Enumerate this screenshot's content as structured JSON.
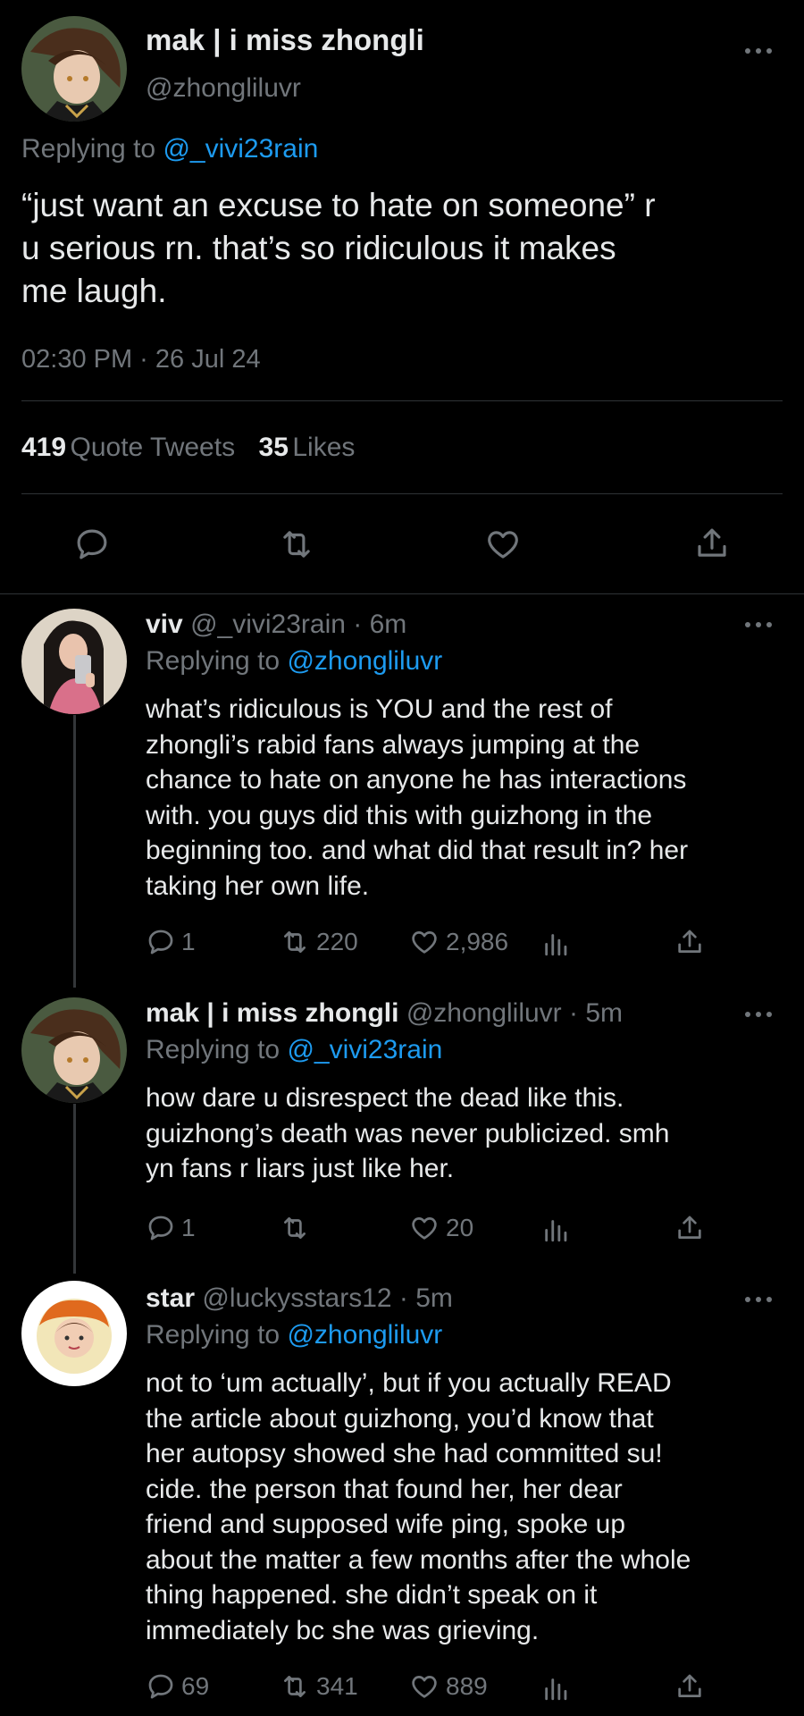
{
  "main_tweet": {
    "display_name": "mak | i miss zhongli",
    "handle": "@zhongliluvr",
    "replying_label": "Replying to",
    "replying_to": "@_vivi23rain",
    "text_lines": [
      "“just want an excuse to hate on someone” r",
      "u serious rn. that’s so ridiculous it makes",
      "me laugh."
    ],
    "timestamp": "02:30 PM · 26 Jul 24",
    "stats": {
      "quote_count": "419",
      "quote_label": "Quote Tweets",
      "like_count": "35",
      "like_label": "Likes"
    }
  },
  "replies": [
    {
      "display_name": "viv",
      "meta": "@_vivi23rain · 6m",
      "replying_label": "Replying to",
      "replying_to": "@zhongliluvr",
      "text_lines": [
        "what’s ridiculous is YOU and the rest of",
        "zhongli’s rabid fans always jumping at the",
        "chance to hate on anyone he has interactions",
        "with. you guys did this with guizhong in the",
        "beginning too. and what did that result in? her",
        "taking her own life."
      ],
      "reply_count": "1",
      "retweet_count": "220",
      "like_count": "2,986"
    },
    {
      "display_name": "mak | i miss zhongli",
      "meta": "@zhongliluvr · 5m",
      "replying_label": "Replying to",
      "replying_to": "@_vivi23rain",
      "text_lines": [
        "how dare u disrespect the dead like this.",
        "guizhong’s death was never publicized. smh",
        "yn fans r liars just like her."
      ],
      "reply_count": "1",
      "retweet_count": "",
      "like_count": "20"
    },
    {
      "display_name": "star",
      "meta": "@luckysstars12 · 5m",
      "replying_label": "Replying to",
      "replying_to": "@zhongliluvr",
      "text_lines": [
        "not to ‘um actually’, but if you actually READ",
        "the article about guizhong, you’d know that",
        "her autopsy showed she had committed su!",
        "cide. the person that found her, her dear",
        "friend and supposed wife ping, spoke up",
        "about the matter a few months after the whole",
        "thing happened. she didn’t speak on it",
        "immediately bc she was grieving."
      ],
      "reply_count": "69",
      "retweet_count": "341",
      "like_count": "889"
    }
  ],
  "icons": {
    "reply": "reply-icon",
    "retweet": "retweet-icon",
    "like": "heart-icon",
    "views": "views-chart-icon",
    "share": "share-icon",
    "more": "more-options-icon"
  },
  "colors": {
    "background": "#000000",
    "text": "#e7e9ea",
    "muted": "#71767b",
    "link": "#1d9bf0",
    "divider": "#2f3336"
  }
}
